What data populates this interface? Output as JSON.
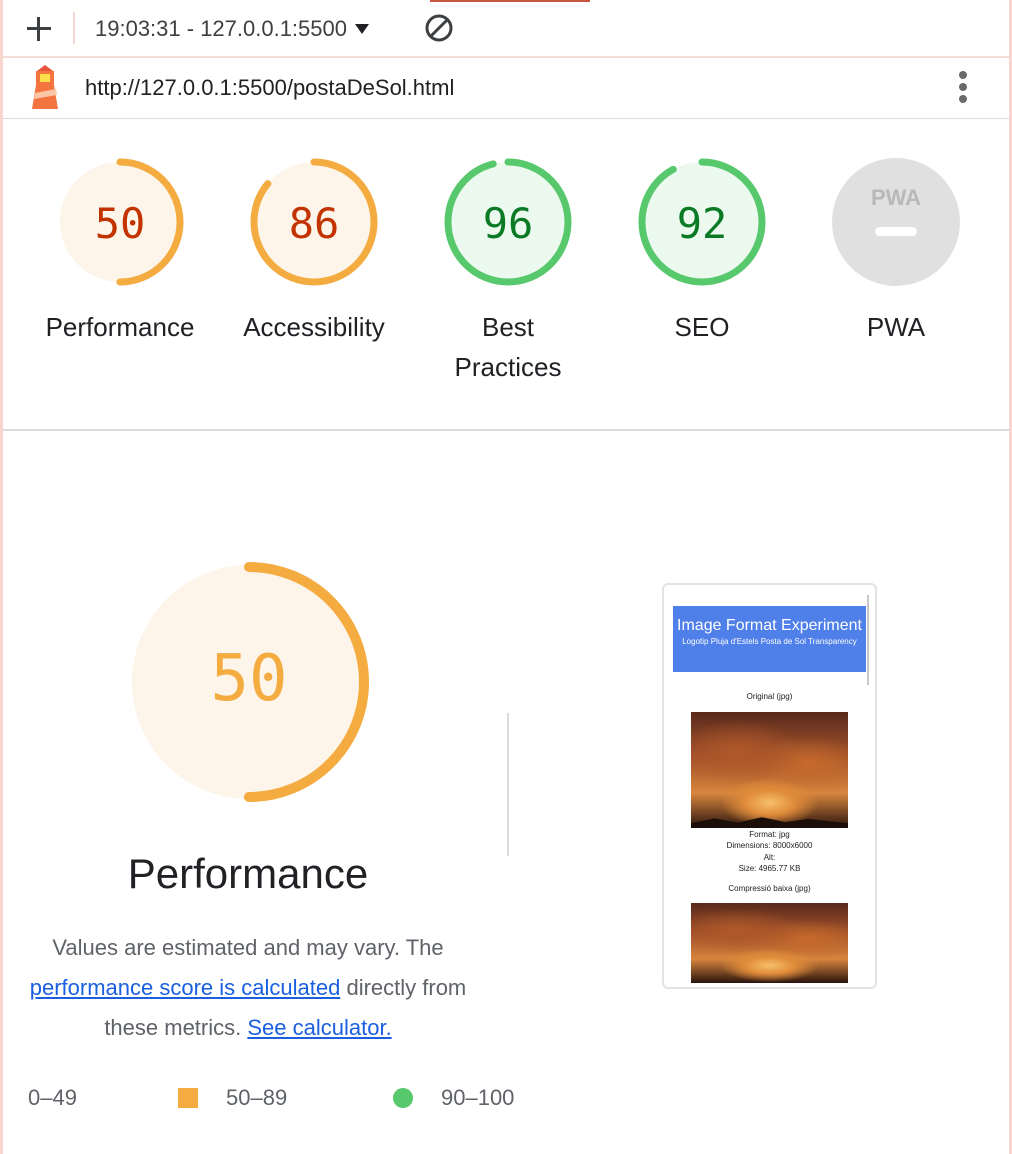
{
  "toolbar": {
    "report_label": "19:03:31 - 127.0.0.1:5500"
  },
  "urlbar": {
    "url": "http://127.0.0.1:5500/postaDeSol.html"
  },
  "gauges": [
    {
      "score": "50",
      "label": "Performance",
      "fraction": 0.5,
      "status": "average"
    },
    {
      "score": "86",
      "label": "Accessibility",
      "fraction": 0.86,
      "status": "average"
    },
    {
      "score": "96",
      "label": "Best Practices",
      "fraction": 0.96,
      "status": "pass"
    },
    {
      "score": "92",
      "label": "SEO",
      "fraction": 0.92,
      "status": "pass"
    },
    {
      "score": "",
      "label": "PWA",
      "badge": "PWA",
      "status": "na"
    }
  ],
  "performance": {
    "score": "50",
    "fraction": 0.5,
    "title": "Performance",
    "desc_1": "Values are estimated and may vary. The",
    "desc_link_1": "performance score is calculated",
    "desc_2": "directly from these metrics.",
    "desc_link_2": "See calculator."
  },
  "legend": {
    "fail": "0–49",
    "average": "50–89",
    "pass": "90–100"
  },
  "thumbnail": {
    "title": "Image Format Experiment",
    "subtitle": "Logotip Pluja d'Estels Posta de Sol Transparency",
    "section_1": "Original (jpg)",
    "format": "Format: jpg",
    "dimensions": "Dimensions: 8000x6000",
    "alt": "Alt:",
    "size": "Size: 4965.77 KB",
    "section_2": "Compressió baixa (jpg)"
  },
  "colors": {
    "average": "#f4ac41",
    "average_text": "#c33300",
    "average_bg": "#fdf4ea",
    "pass": "#57c86b",
    "pass_text": "#0b7a25",
    "pass_bg": "#ecf9ef",
    "na": "#e0e0e0",
    "link": "#1a5fe0"
  }
}
